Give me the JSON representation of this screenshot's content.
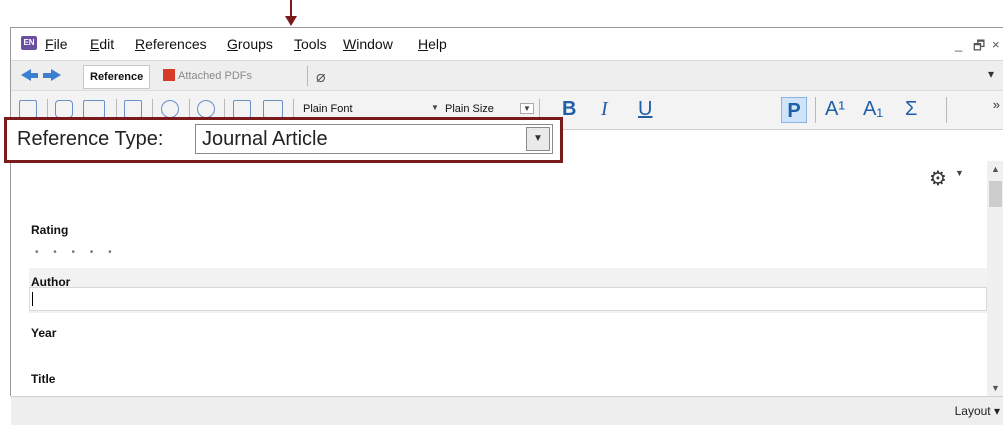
{
  "app_icon": "EN",
  "menu": {
    "items": [
      "File",
      "Edit",
      "References",
      "Groups",
      "Tools",
      "Window",
      "Help"
    ],
    "underline": [
      "F",
      "E",
      "R",
      "G",
      "T",
      "W",
      "H"
    ]
  },
  "window_controls": {
    "minimize": "_",
    "restore": "🗗",
    "close": "×"
  },
  "tabs": {
    "reference": "Reference",
    "attached_pdfs": "Attached PDFs"
  },
  "toolbar": {
    "font_value": "Plain Font",
    "size_value": "Plain Size",
    "bold": "B",
    "italic": "I",
    "underline": "U",
    "plain": "P",
    "superscript": "A¹",
    "subscript": "A₁",
    "symbol": "Σ",
    "more": "»"
  },
  "reference_type": {
    "label": "Reference Type:",
    "value": "Journal Article"
  },
  "fields": {
    "rating_label": "Rating",
    "rating_dots": "• • • • •",
    "author_label": "Author",
    "year_label": "Year",
    "title_label": "Title"
  },
  "status": {
    "layout": "Layout ▾"
  },
  "colors": {
    "annotation": "#7a1a1a",
    "accent": "#1f5fa8"
  }
}
